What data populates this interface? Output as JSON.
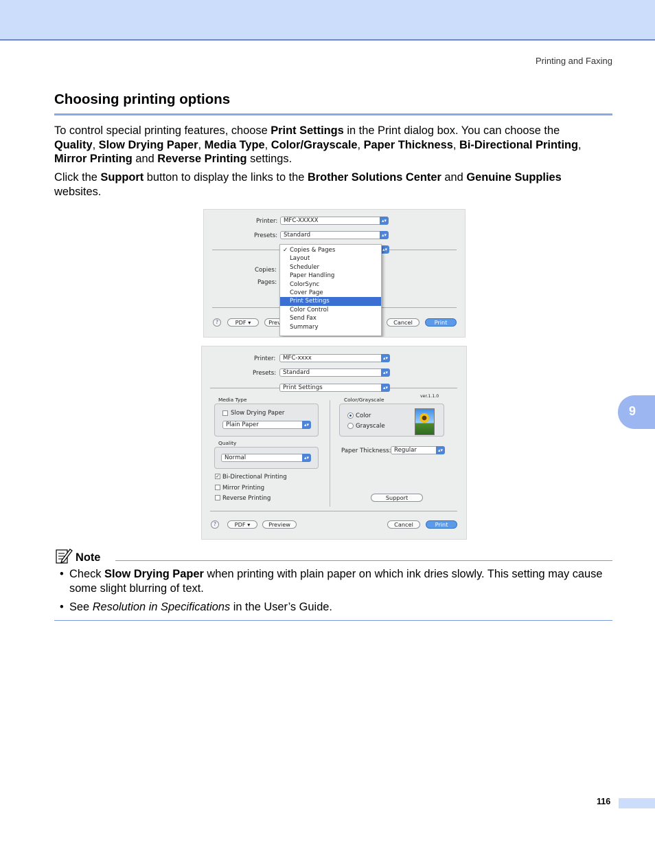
{
  "running_head": "Printing and Faxing",
  "section_title": "Choosing printing options",
  "paragraph1": {
    "t1": "To control special printing features, choose ",
    "b1": "Print Settings",
    "t2": " in the Print dialog box. You can choose the ",
    "b2": "Quality",
    "t3": ", ",
    "b3": "Slow Drying Paper",
    "t4": ", ",
    "b4": "Media Type",
    "t5": ", ",
    "b5": "Color/Grayscale",
    "t6": ", ",
    "b6": "Paper Thickness",
    "t7": ", ",
    "b7": "Bi-Directional Printing",
    "t8": ", ",
    "b8": "Mirror Printing",
    "t9": " and ",
    "b9": "Reverse Printing",
    "t10": " settings."
  },
  "paragraph2": {
    "t1": "Click the ",
    "b1": "Support",
    "t2": " button to display the links to the ",
    "b2": "Brother Solutions Center",
    "t3": " and ",
    "b3": "Genuine Supplies",
    "t4": " websites."
  },
  "dialog1": {
    "printer_label": "Printer:",
    "printer_value": "MFC-XXXXX",
    "presets_label": "Presets:",
    "presets_value": "Standard",
    "copies_label": "Copies:",
    "pages_label": "Pages:",
    "menu_items": [
      "Copies & Pages",
      "Layout",
      "Scheduler",
      "Paper Handling",
      "ColorSync",
      "Cover Page",
      "Print Settings",
      "Color Control",
      "Send Fax",
      "Summary"
    ],
    "checked_index": 0,
    "selected_index": 6,
    "help": "?",
    "pdf_button": "PDF ▾",
    "preview_button_partial": "Prev",
    "cancel_button": "Cancel",
    "print_button": "Print"
  },
  "dialog2": {
    "printer_label": "Printer:",
    "printer_value": "MFC-xxxx",
    "presets_label": "Presets:",
    "presets_value": "Standard",
    "panel_value": "Print Settings",
    "media_type_label": "Media Type",
    "slow_drying_label": "Slow Drying Paper",
    "slow_drying_checked": false,
    "media_value": "Plain Paper",
    "quality_label": "Quality",
    "quality_value": "Normal",
    "bidirectional_label": "Bi-Directional Printing",
    "bidirectional_checked": true,
    "mirror_label": "Mirror Printing",
    "mirror_checked": false,
    "reverse_label": "Reverse Printing",
    "reverse_checked": false,
    "color_group_label": "Color/Grayscale",
    "version": "ver.1.1.0",
    "color_label": "Color",
    "grayscale_label": "Grayscale",
    "color_selected": "Color",
    "thickness_label": "Paper Thickness:",
    "thickness_value": "Regular",
    "support_button": "Support",
    "help": "?",
    "pdf_button": "PDF ▾",
    "preview_button": "Preview",
    "cancel_button": "Cancel",
    "print_button": "Print"
  },
  "note": {
    "label": "Note",
    "bullet_symbol": "•",
    "item1": {
      "t1": "Check ",
      "b1": "Slow Drying Paper",
      "t2": " when printing with plain paper on which ink dries slowly. This setting may cause some slight blurring of text."
    },
    "item2": {
      "t1": "See ",
      "i1": "Resolution in Specifications",
      "t2": " in the User’s Guide."
    }
  },
  "chapter_tab": "9",
  "page_number": "116"
}
